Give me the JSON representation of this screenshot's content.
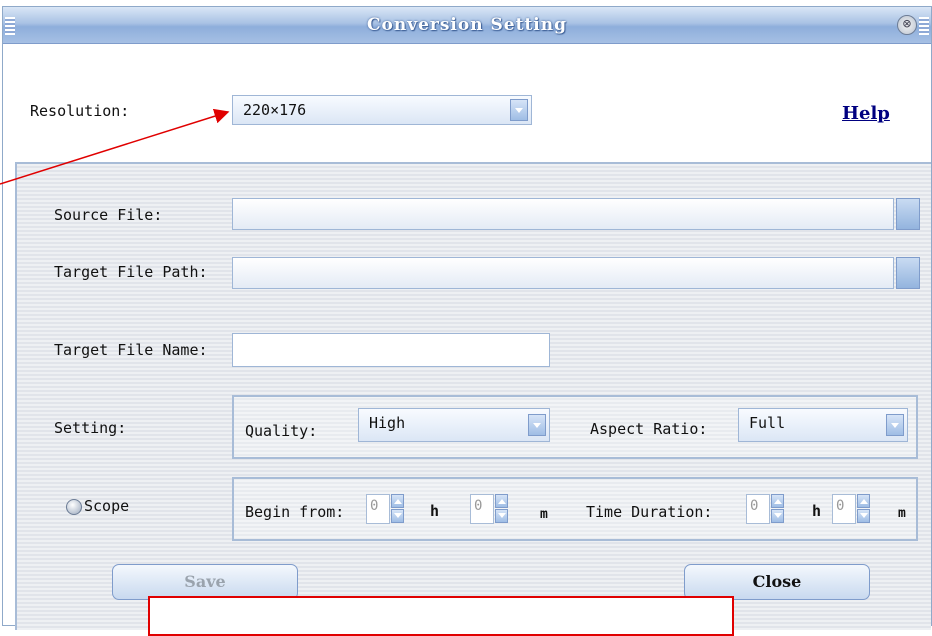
{
  "window": {
    "title": "Conversion Setting",
    "close_glyph": "⊗"
  },
  "resolution": {
    "label": "Resolution:",
    "value": "220×176"
  },
  "help": {
    "label": "Help"
  },
  "source_file": {
    "label": "Source File:",
    "value": ""
  },
  "target_path": {
    "label": "Target File Path:",
    "value": ""
  },
  "target_name": {
    "label": "Target File Name:",
    "value": ""
  },
  "setting": {
    "label": "Setting:",
    "quality_label": "Quality:",
    "quality_value": "High",
    "aspect_label": "Aspect Ratio:",
    "aspect_value": "Full"
  },
  "scope": {
    "label": "Scope",
    "begin_label": "Begin from:",
    "begin_h": "0",
    "h_unit": "h",
    "begin_m": "0",
    "m_unit": "m",
    "duration_label": "Time Duration:",
    "duration_h": "0",
    "duration_m": "0"
  },
  "buttons": {
    "save": "Save",
    "close": "Close"
  },
  "colors": {
    "callout": "#e00000",
    "help_link": "#000080",
    "title_bar": "#a9c2e4"
  }
}
